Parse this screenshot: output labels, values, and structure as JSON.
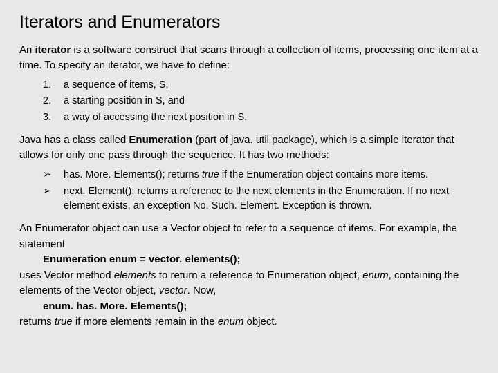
{
  "title": "Iterators and Enumerators",
  "intro": {
    "pre": "An ",
    "kw": "iterator",
    "post": " is a software construct that scans through a collection of items, processing one item at a time. To specify an iterator, we have to define:"
  },
  "numlist": [
    {
      "n": "1.",
      "t": "a sequence of items, S,"
    },
    {
      "n": "2.",
      "t": "a starting position in S, and"
    },
    {
      "n": "3.",
      "t": "a way of accessing the next position in S."
    }
  ],
  "java": {
    "pre": "Java has a class called ",
    "kw": "Enumeration",
    "post": " (part of java. util package), which is a simple iterator that allows for only one pass through the sequence. It has two methods:"
  },
  "methods": [
    {
      "name": "has. More. Elements(); returns ",
      "ital": "true",
      "rest": " if the Enumeration object contains more items."
    },
    {
      "name": "next. Element(); returns a reference to the next elements in the Enumeration. If no next element exists, an exception No. Such. Element. Exception is thrown.",
      "ital": "",
      "rest": ""
    }
  ],
  "tail": {
    "l1": "An Enumerator object can use a Vector object to refer to a sequence of items. For example, the statement",
    "code1": "Enumeration enum = vector. elements();",
    "l2a": "uses Vector method ",
    "l2i1": "elements",
    "l2b": " to return a reference to Enumeration object, ",
    "l2i2": "enum",
    "l2c": ", containing the elements of the Vector object, ",
    "l2i3": "vector",
    "l2d": ". Now,",
    "code2": "enum. has. More. Elements();",
    "l3a": "returns ",
    "l3i1": "true",
    "l3b": " if more elements remain in the ",
    "l3i2": "enum",
    "l3c": " object."
  },
  "arrow": "➢"
}
